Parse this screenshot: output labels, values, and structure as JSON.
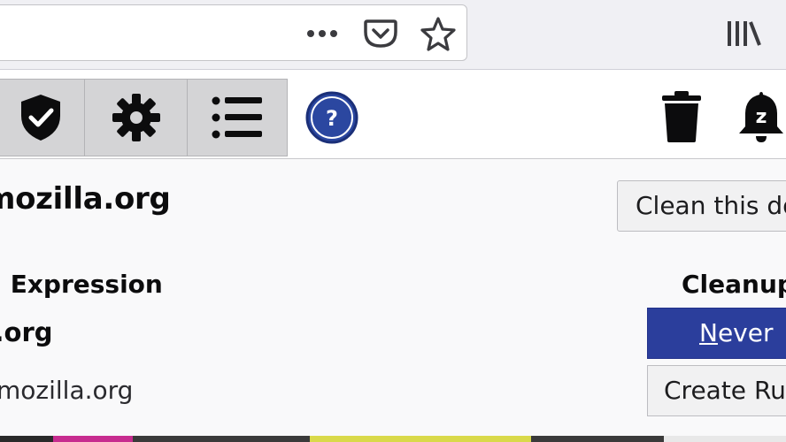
{
  "browser": {
    "toolbar_icons": [
      "more-icon",
      "pocket-icon",
      "bookmark-star-icon",
      "library-icon"
    ]
  },
  "popup": {
    "tabs": [
      {
        "icon": "shield-check-icon"
      },
      {
        "icon": "gear-icon"
      },
      {
        "icon": "list-icon"
      }
    ],
    "help_icon_text": "?",
    "header_icons": [
      "trash-icon",
      "snooze-bell-icon"
    ],
    "snooze_label": "z",
    "domain": "mozilla.org",
    "clean_button": "Clean this domain",
    "columns": {
      "expression": "ng Expression",
      "cleanup": "Cleanup"
    },
    "rules": [
      {
        "expression": "la.org",
        "action_prefix": "N",
        "action_rest": "ever"
      },
      {
        "expression": "mozilla.org",
        "action": "Create Rule"
      }
    ]
  },
  "colors": {
    "accent": "#2b3e9c",
    "help_circle": "#2b47a0",
    "tab_bg": "#d4d4d6",
    "strip": [
      "#2a2a2a",
      "#c72c8f",
      "#3a3a3a",
      "#d9d94a",
      "#3a3a3a",
      "#e8e8e8"
    ]
  }
}
